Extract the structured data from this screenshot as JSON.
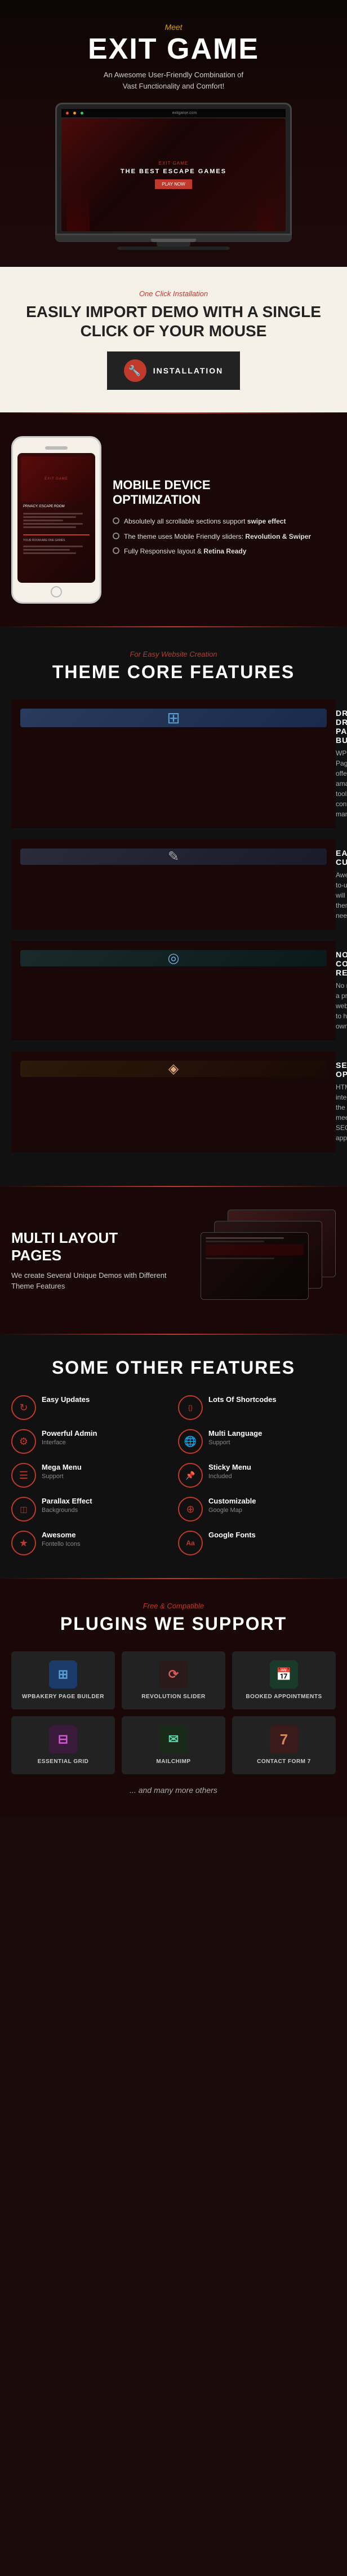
{
  "hero": {
    "meet_label": "Meet",
    "title": "EXIT GAME",
    "subtitle": "An Awesome User-Friendly Combination of\nVast Functionality and Comfort!",
    "screen_text": "THE BEST ESCAPE GAMES"
  },
  "install": {
    "one_click_label": "One Click Installation",
    "title_line1": "EASILY IMPORT DEMO WITH A SINGLE",
    "title_line2": "CLICK OF YOUR MOUSE",
    "button_label": "INSTALLATION"
  },
  "mobile": {
    "title_line1": "MOBILE DEVICE",
    "title_line2": "OPTIMIZATION",
    "features": [
      "Absolutely all scrollable sections support swipe effect",
      "The theme uses Mobile Friendly sliders: Revolution & Swiper",
      "Fully Responsive layout & Retina Ready"
    ]
  },
  "core": {
    "label": "For Easy Website Creation",
    "title": "THEME CORE FEATURES",
    "items": [
      {
        "title": "DRAG & DROP PAGE BUILDER",
        "desc": "WPBakery Page Builder offers amazing tools for content management",
        "icon": "⊞"
      },
      {
        "title": "EASY TO CUSTOMIZE",
        "desc": "Awesome easy-to-use options will adjust the theme to your needs",
        "icon": "✎"
      },
      {
        "title": "NO CODING REQUIRED",
        "desc": "No need to be a professional web developer to have your own website",
        "icon": "◎"
      },
      {
        "title": "SEO OPTIMIZED",
        "desc": "HTML code integrated into the theme meets the best SEO approaches",
        "icon": "◈"
      }
    ]
  },
  "multi": {
    "title_line1": "MULTI LAYOUT",
    "title_line2": "PAGES",
    "desc": "We create Several Unique Demos with Different Theme Features"
  },
  "other_features": {
    "title": "SOME OTHER FEATURES",
    "items": [
      {
        "label": "Easy Updates",
        "icon": "↻",
        "col": 1
      },
      {
        "label": "Lots of Shortcodes",
        "icon": "{ }",
        "col": 2
      },
      {
        "label": "Powerful Admin Interface",
        "icon": "⚙",
        "col": 1
      },
      {
        "label": "Multi Language Support",
        "icon": "🌐",
        "col": 2
      },
      {
        "label": "Mega Menu Support",
        "icon": "☰",
        "col": 1
      },
      {
        "label": "Sticky Menu Included",
        "icon": "📌",
        "col": 2
      },
      {
        "label": "Parallax Effect Backgrounds",
        "icon": "◫",
        "col": 1
      },
      {
        "label": "Customizable Google Map",
        "icon": "⊕",
        "col": 2
      },
      {
        "label": "Awesome Fontello Icons",
        "icon": "★",
        "col": 1
      },
      {
        "label": "Google Fonts",
        "icon": "Aa",
        "col": 2
      }
    ]
  },
  "plugins": {
    "label": "Free & Compatible",
    "title": "PLUGINS WE SUPPORT",
    "items": [
      {
        "name": "WPBAKERY PAGE BUILDER",
        "icon": "⊞",
        "class": "pi-wpbakery"
      },
      {
        "name": "REVOLUTION SLIDER",
        "icon": "⟳",
        "class": "pi-revolution"
      },
      {
        "name": "BOOKED APPOINTMENTS",
        "icon": "📅",
        "class": "pi-booked"
      },
      {
        "name": "ESSENTIAL GRID",
        "icon": "⊟",
        "class": "pi-essential"
      },
      {
        "name": "MAILCHIMP",
        "icon": "✉",
        "class": "pi-mailchimp"
      },
      {
        "name": "CONTACT FORM 7",
        "icon": "7",
        "class": "pi-cf7"
      }
    ],
    "more_label": "... and many more others"
  }
}
